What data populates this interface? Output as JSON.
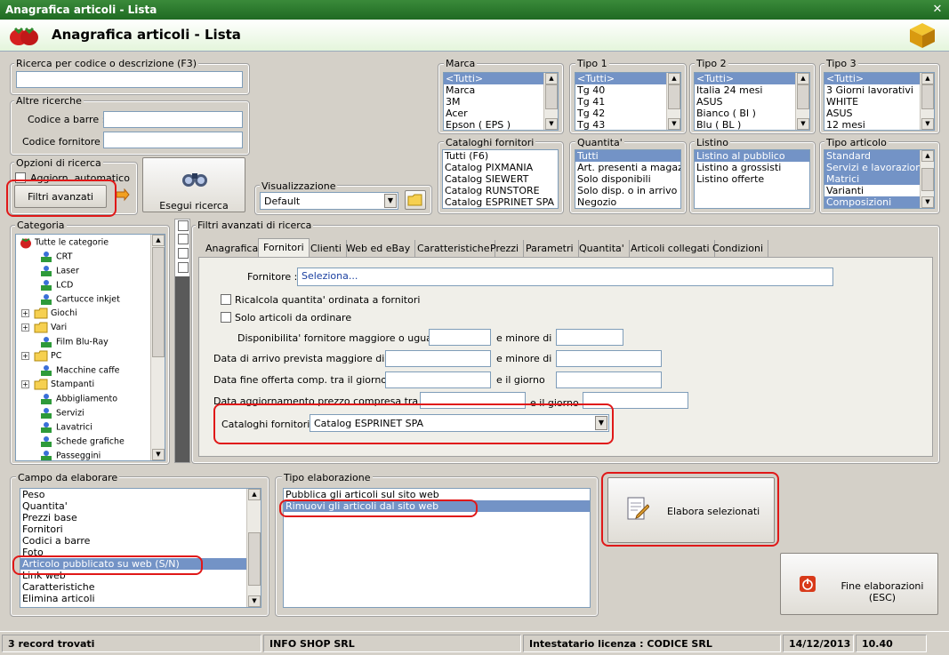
{
  "window": {
    "title": "Anagrafica articoli  - Lista",
    "header": "Anagrafica articoli  - Lista"
  },
  "search": {
    "group": "Ricerca per codice o descrizione (F3)",
    "value": ""
  },
  "altre": {
    "group": "Altre ricerche",
    "barcode_label": "Codice a barre :",
    "supplier_label": "Codice fornitore :"
  },
  "opzioni": {
    "group": "Opzioni di ricerca",
    "auto_label": "Aggiorn. automatico",
    "filtri_btn": "Filtri avanzati",
    "esegui_btn": "Esegui ricerca"
  },
  "visual": {
    "group": "Visualizzazione",
    "value": "Default"
  },
  "marca": {
    "group": "Marca",
    "items": [
      "<Tutti>",
      "Marca",
      "3M",
      "Acer",
      "Epson ( EPS )"
    ]
  },
  "tipo1": {
    "group": "Tipo 1",
    "items": [
      "<Tutti>",
      "Tg 40",
      "Tg 41",
      "Tg 42",
      "Tg 43"
    ]
  },
  "tipo2": {
    "group": "Tipo 2",
    "items": [
      "<Tutti>",
      "Italia 24 mesi",
      "ASUS",
      "Bianco ( BI )",
      "Blu ( BL )"
    ]
  },
  "tipo3": {
    "group": "Tipo 3",
    "items": [
      "<Tutti>",
      "3 Giorni lavorativi",
      "WHITE",
      "ASUS",
      "12 mesi"
    ]
  },
  "cataloghi": {
    "group": "Cataloghi fornitori",
    "items": [
      "Tutti (F6)",
      "Catalog PIXMANIA",
      "Catalog SIEWERT",
      "Catalog RUNSTORE",
      "Catalog ESPRINET SPA"
    ]
  },
  "quantita": {
    "group": "Quantita'",
    "items": [
      "Tutti",
      "Art. presenti a magazzino",
      "Solo disponibili",
      "Solo disp. o in arrivo",
      "Negozio"
    ]
  },
  "listino": {
    "group": "Listino",
    "items": [
      "Listino al pubblico",
      "Listino a grossisti",
      "Listino offerte"
    ]
  },
  "tipoart": {
    "group": "Tipo articolo",
    "items": [
      "Standard",
      "Servizi e lavorazioni",
      "Matrici",
      "Varianti",
      "Composizioni"
    ]
  },
  "categoria": {
    "group": "Categoria",
    "items": [
      "Tutte le categorie",
      "CRT",
      "Laser",
      "LCD",
      "Cartucce inkjet",
      "Giochi",
      "Vari",
      "Film Blu-Ray",
      "PC",
      "Macchine caffe",
      "Stampanti",
      "Abbigliamento",
      "Servizi",
      "Lavatrici",
      "Schede grafiche",
      "Passeggini"
    ]
  },
  "filtri": {
    "group": "Filtri avanzati di ricerca",
    "tabs": [
      "Anagrafica",
      "Fornitori",
      "Clienti",
      "Web ed eBay",
      "Caratteristiche",
      "Prezzi",
      "Parametri",
      "Quantita'",
      "Articoli collegati",
      "Condizioni"
    ],
    "fornitore_label": "Fornitore :",
    "fornitore_value": "Seleziona...",
    "ricalcola": "Ricalcola quantita' ordinata a fornitori",
    "solo_ordinare": "Solo articoli da ordinare",
    "disp_label": "Disponibilita' fornitore maggiore o uguale a",
    "minore_di": "e minore di",
    "arrivo_label": "Data di arrivo prevista maggiore di",
    "fine_label": "Data fine offerta comp. tra il giorno",
    "il_giorno": "e il giorno",
    "agg_label": "Data aggiornamento prezzo compresa tra",
    "cat_label": "Cataloghi fornitori :",
    "cat_value": "Catalog ESPRINET SPA"
  },
  "campo": {
    "group": "Campo da elaborare",
    "items": [
      "Peso",
      "Quantita'",
      "Prezzi base",
      "Fornitori",
      "Codici a barre",
      "Foto",
      "Articolo pubblicato su web (S/N)",
      "Link web",
      "Caratteristiche",
      "Elimina articoli"
    ]
  },
  "tipoel": {
    "group": "Tipo elaborazione",
    "items": [
      "Pubblica gli articoli sul sito web",
      "Rimuovi gli articoli dal sito web"
    ]
  },
  "actions": {
    "elabora": "Elabora selezionati",
    "fine": "Fine elaborazioni (ESC)"
  },
  "status": {
    "records": "3 record trovati",
    "company": "INFO SHOP SRL",
    "license": "Intestatario licenza : CODICE SRL",
    "date": "14/12/2013",
    "time": "10.40"
  }
}
